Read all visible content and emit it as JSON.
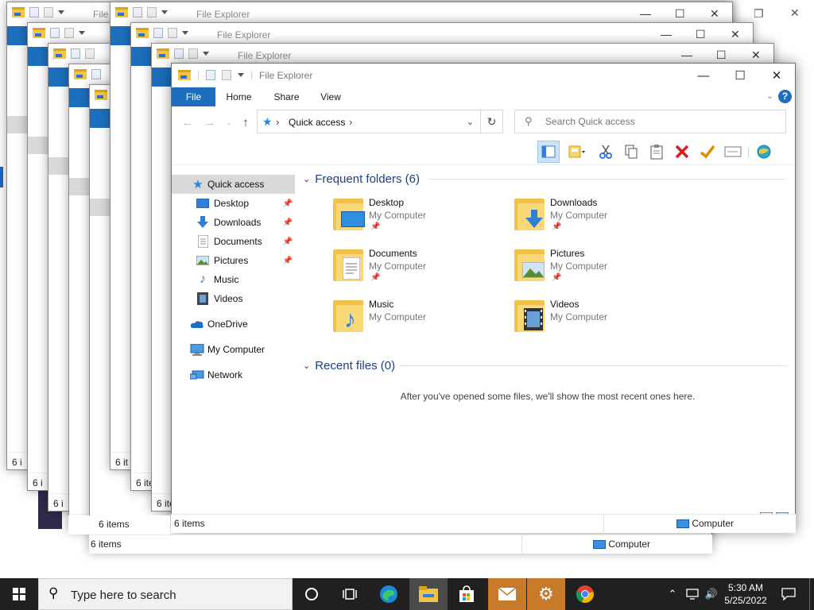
{
  "window": {
    "title": "File Explorer",
    "ghost_title": "File Explorer",
    "ghost_title_short": "File",
    "minimize": "—",
    "maximize": "☐",
    "close": "✕"
  },
  "ribbon": {
    "tabs": [
      "File",
      "Home",
      "Share",
      "View"
    ],
    "help": "?"
  },
  "address": {
    "location": "Quick access",
    "search_placeholder": "Search Quick access"
  },
  "nav": {
    "items": [
      {
        "label": "Quick access",
        "icon": "star-icon",
        "pinned": false,
        "selected": true
      },
      {
        "label": "Desktop",
        "icon": "desktop-icon",
        "pinned": true
      },
      {
        "label": "Downloads",
        "icon": "download-icon",
        "pinned": true
      },
      {
        "label": "Documents",
        "icon": "document-icon",
        "pinned": true
      },
      {
        "label": "Pictures",
        "icon": "picture-icon",
        "pinned": true
      },
      {
        "label": "Music",
        "icon": "music-icon",
        "pinned": false
      },
      {
        "label": "Videos",
        "icon": "video-icon",
        "pinned": false
      },
      {
        "label": "OneDrive",
        "icon": "cloud-icon",
        "pinned": false
      },
      {
        "label": "My Computer",
        "icon": "computer-icon",
        "pinned": false
      },
      {
        "label": "Network",
        "icon": "network-icon",
        "pinned": false
      }
    ]
  },
  "frequent": {
    "header": "Frequent folders (6)",
    "folders": [
      {
        "name": "Desktop",
        "location": "My Computer",
        "pinned": true
      },
      {
        "name": "Downloads",
        "location": "My Computer",
        "pinned": true
      },
      {
        "name": "Documents",
        "location": "My Computer",
        "pinned": true
      },
      {
        "name": "Pictures",
        "location": "My Computer",
        "pinned": true
      },
      {
        "name": "Music",
        "location": "My Computer",
        "pinned": false
      },
      {
        "name": "Videos",
        "location": "My Computer",
        "pinned": false
      }
    ]
  },
  "recent": {
    "header": "Recent files (0)",
    "empty_message": "After you've opened some files, we'll show the most recent ones here."
  },
  "status": {
    "item_count": "6 items",
    "item_count_short": "6 i",
    "item_count_short2": "6 it",
    "item_count_short3": "6 ite",
    "item_count_short4": "6 item",
    "computer_label": "Computer"
  },
  "taskbar": {
    "search_placeholder": "Type here to search",
    "time": "5:30 AM",
    "date": "5/25/2022"
  },
  "colors": {
    "accent": "#1d6fbe",
    "taskbar": "#202020",
    "folder": "#f0c24a",
    "delete_red": "#d21f1f",
    "check_orange": "#e68a00"
  }
}
